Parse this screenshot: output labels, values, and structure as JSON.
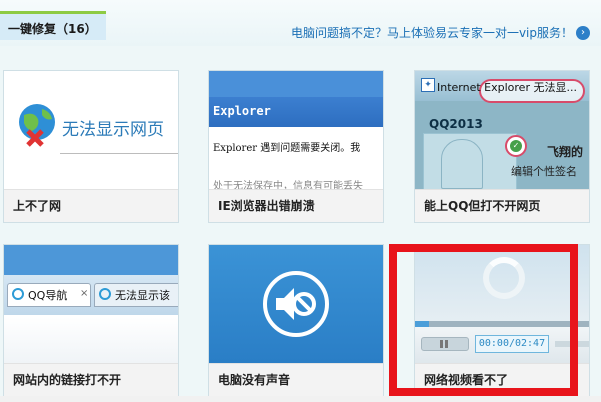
{
  "header": {
    "title": "一键修复（16）",
    "promo": "电脑问题搞不定？马上体验易云专家一对一vip服务！",
    "promo_arrow": "›"
  },
  "cards": [
    {
      "label": "上不了网",
      "thumb_text": "无法显示网页"
    },
    {
      "label": "IE浏览器出错崩溃",
      "window_title": "Explorer",
      "body_text": "Explorer 遇到问题需要关闭。我",
      "body_text_2": "处于无法保存中，信息有可能丢失"
    },
    {
      "label": "能上QQ但打不开网页",
      "window_title": "Internet Explorer 无法显...",
      "qq_title": "QQ2013",
      "username": "飞翔的",
      "signature": "编辑个性签名"
    },
    {
      "label": "网站内的链接打不开",
      "tab1": "QQ导航",
      "tab1_close": "×",
      "tab2": "无法显示该"
    },
    {
      "label": "电脑没有声音"
    },
    {
      "label": "网络视频看不了",
      "time": "00:00/02:47",
      "progress": 0.08
    }
  ],
  "colors": {
    "accent": "#8ecb43",
    "link": "#1a6fb5",
    "highlight": "#e8141b"
  },
  "icons": {
    "globe": "globe-error-icon",
    "speaker": "mute-speaker-icon",
    "spinner": "loading-spinner-icon"
  }
}
